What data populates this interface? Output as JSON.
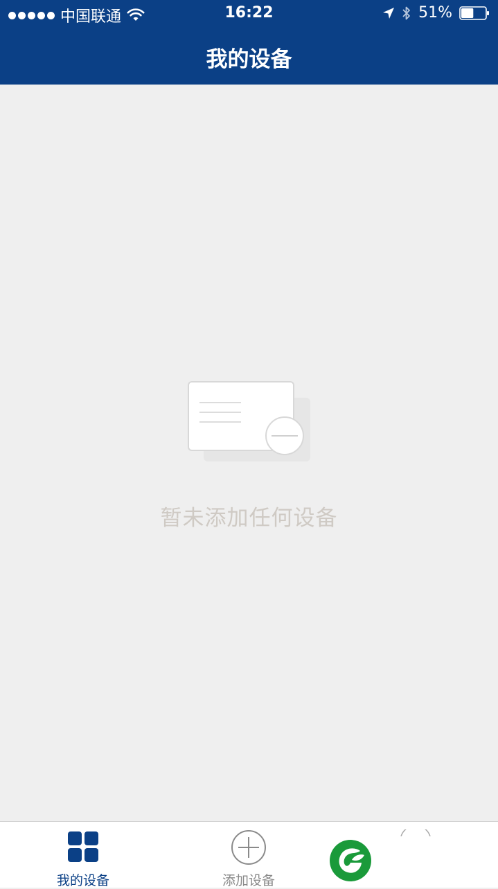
{
  "status_bar": {
    "carrier": "中国联通",
    "time": "16:22",
    "battery_percent": "51%",
    "battery_level": 0.51,
    "icons": [
      "signal-dots-icon",
      "wifi-icon",
      "location-arrow-icon",
      "bluetooth-icon",
      "battery-icon"
    ]
  },
  "header": {
    "title": "我的设备",
    "background_color": "#0b4086"
  },
  "empty_state": {
    "icon": "empty-device-card-icon",
    "message": "暂未添加任何设备"
  },
  "tab_bar": {
    "tabs": [
      {
        "label": "我的设备",
        "icon": "grid-icon",
        "active": true
      },
      {
        "label": "添加设备",
        "icon": "add-circle-icon",
        "active": false
      }
    ],
    "brand_logo": "brand-leaf-logo-icon",
    "active_color": "#0b4086",
    "inactive_color": "#8a8a8a",
    "logo_color": "#1a9a3a"
  }
}
